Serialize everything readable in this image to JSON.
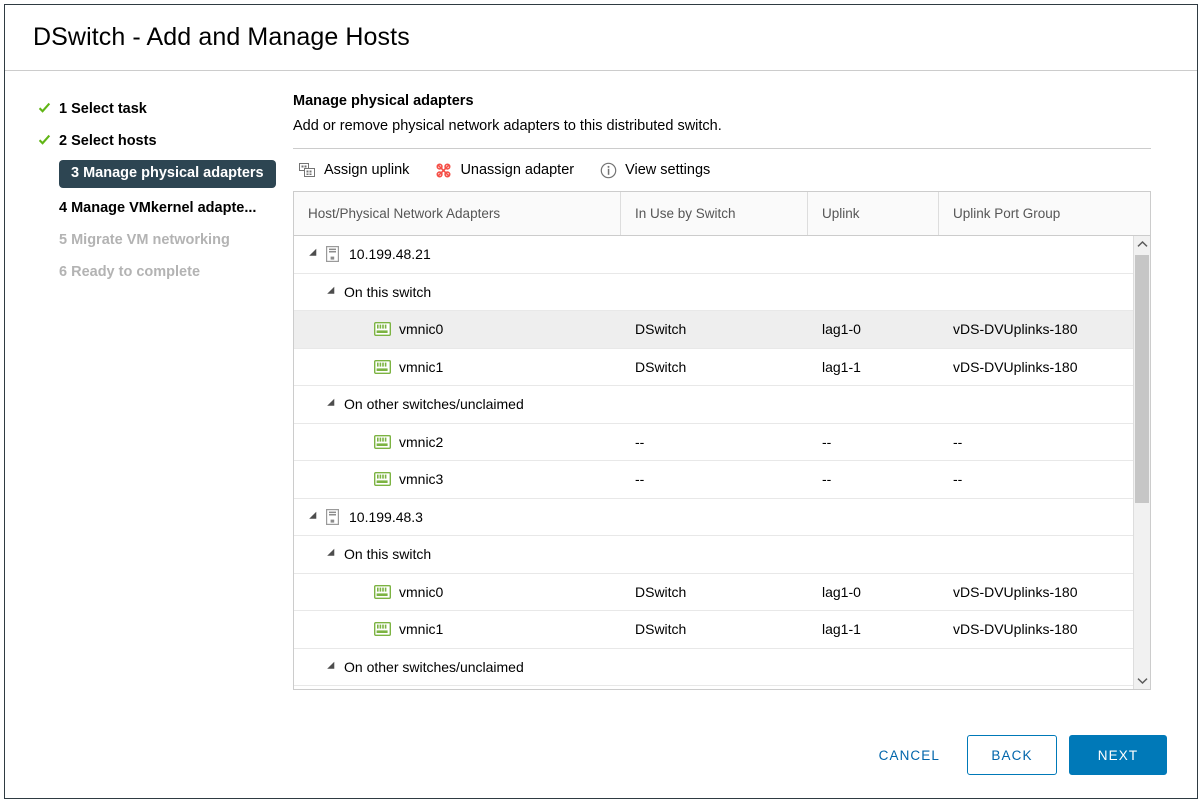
{
  "dialog": {
    "title": "DSwitch - Add and Manage Hosts"
  },
  "sidebar": {
    "steps": [
      {
        "num": "1",
        "label": "1 Select task",
        "state": "done"
      },
      {
        "num": "2",
        "label": "2 Select hosts",
        "state": "done"
      },
      {
        "num": "3",
        "label": "3 Manage physical adapters",
        "state": "active"
      },
      {
        "num": "4",
        "label": "4 Manage VMkernel adapte...",
        "state": "pending"
      },
      {
        "num": "5",
        "label": "5 Migrate VM networking",
        "state": "upcoming"
      },
      {
        "num": "6",
        "label": "6 Ready to complete",
        "state": "upcoming"
      }
    ]
  },
  "main": {
    "title": "Manage physical adapters",
    "subtitle": "Add or remove physical network adapters to this distributed switch.",
    "toolbar": [
      {
        "id": "assign-uplink",
        "label": "Assign uplink",
        "icon": "assign-uplink-icon"
      },
      {
        "id": "unassign-adapter",
        "label": "Unassign adapter",
        "icon": "unassign-adapter-icon"
      },
      {
        "id": "view-settings",
        "label": "View settings",
        "icon": "info-icon"
      }
    ],
    "table": {
      "columns": [
        "Host/Physical Network Adapters",
        "In Use by Switch",
        "Uplink",
        "Uplink Port Group"
      ],
      "rows": [
        {
          "type": "host",
          "label": "10.199.48.21",
          "switch": "",
          "uplink": "",
          "portgroup": "",
          "selected": false
        },
        {
          "type": "group",
          "label": "On this switch",
          "switch": "",
          "uplink": "",
          "portgroup": "",
          "selected": false
        },
        {
          "type": "nic",
          "label": "vmnic0",
          "switch": "DSwitch",
          "uplink": "lag1-0",
          "portgroup": "vDS-DVUplinks-180",
          "selected": true
        },
        {
          "type": "nic",
          "label": "vmnic1",
          "switch": "DSwitch",
          "uplink": "lag1-1",
          "portgroup": "vDS-DVUplinks-180",
          "selected": false
        },
        {
          "type": "group",
          "label": "On other switches/unclaimed",
          "switch": "",
          "uplink": "",
          "portgroup": "",
          "selected": false
        },
        {
          "type": "nic",
          "label": "vmnic2",
          "switch": "--",
          "uplink": "--",
          "portgroup": "--",
          "selected": false
        },
        {
          "type": "nic",
          "label": "vmnic3",
          "switch": "--",
          "uplink": "--",
          "portgroup": "--",
          "selected": false
        },
        {
          "type": "host",
          "label": "10.199.48.3",
          "switch": "",
          "uplink": "",
          "portgroup": "",
          "selected": false
        },
        {
          "type": "group",
          "label": "On this switch",
          "switch": "",
          "uplink": "",
          "portgroup": "",
          "selected": false
        },
        {
          "type": "nic",
          "label": "vmnic0",
          "switch": "DSwitch",
          "uplink": "lag1-0",
          "portgroup": "vDS-DVUplinks-180",
          "selected": false
        },
        {
          "type": "nic",
          "label": "vmnic1",
          "switch": "DSwitch",
          "uplink": "lag1-1",
          "portgroup": "vDS-DVUplinks-180",
          "selected": false
        },
        {
          "type": "group",
          "label": "On other switches/unclaimed",
          "switch": "",
          "uplink": "",
          "portgroup": "",
          "selected": false
        }
      ]
    }
  },
  "footer": {
    "cancel_label": "CANCEL",
    "back_label": "BACK",
    "next_label": "NEXT"
  },
  "colors": {
    "accent": "#0079b8",
    "link": "#0065ab",
    "active_step_bg": "#2d4552",
    "check_green": "#60b515",
    "nic_green": "#7cb342",
    "unassign_red": "#f54f47",
    "selected_row": "#eeeeee"
  }
}
